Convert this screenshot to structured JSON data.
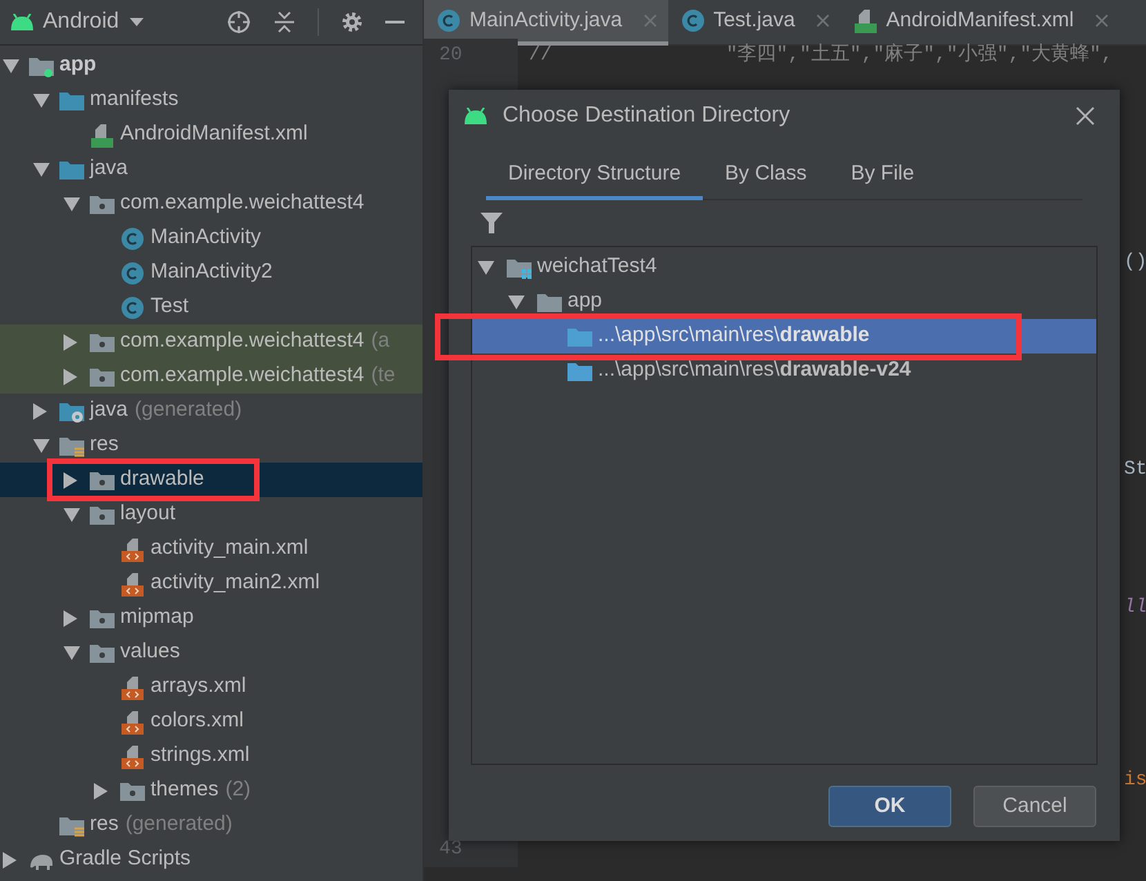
{
  "project_panel": {
    "view": "Android",
    "tree": [
      {
        "label": "app",
        "kind": "module",
        "bold": true,
        "expanded": true,
        "selected": false,
        "highlighted": false,
        "marked": false,
        "children": [
          {
            "label": "manifests",
            "kind": "folder",
            "expanded": true,
            "selected": false,
            "highlighted": false,
            "marked": false,
            "children": [
              {
                "label": "AndroidManifest.xml",
                "kind": "manifest",
                "selected": false,
                "highlighted": false,
                "marked": false
              }
            ]
          },
          {
            "label": "java",
            "kind": "folder",
            "expanded": true,
            "selected": false,
            "highlighted": false,
            "marked": false,
            "children": [
              {
                "label": "com.example.weichattest4",
                "kind": "package",
                "expanded": true,
                "selected": false,
                "highlighted": false,
                "marked": false,
                "children": [
                  {
                    "label": "MainActivity",
                    "kind": "class",
                    "selected": false,
                    "highlighted": false,
                    "marked": false
                  },
                  {
                    "label": "MainActivity2",
                    "kind": "class",
                    "selected": false,
                    "highlighted": false,
                    "marked": false
                  },
                  {
                    "label": "Test",
                    "kind": "class",
                    "selected": false,
                    "highlighted": false,
                    "marked": false
                  }
                ]
              },
              {
                "label": "com.example.weichattest4",
                "suffix": "(a",
                "kind": "package",
                "expanded": false,
                "selected": false,
                "highlighted": true,
                "marked": false
              },
              {
                "label": "com.example.weichattest4",
                "suffix": "(te",
                "kind": "package",
                "expanded": false,
                "selected": false,
                "highlighted": true,
                "marked": false
              }
            ]
          },
          {
            "label": "java",
            "suffix": "(generated)",
            "kind": "generated_folder",
            "expanded": false,
            "selected": false,
            "highlighted": false,
            "marked": false
          },
          {
            "label": "res",
            "kind": "res_folder",
            "expanded": true,
            "selected": false,
            "highlighted": false,
            "marked": false,
            "children": [
              {
                "label": "drawable",
                "kind": "package",
                "expanded": false,
                "selected": true,
                "highlighted": false,
                "marked": true
              },
              {
                "label": "layout",
                "kind": "package",
                "expanded": true,
                "selected": false,
                "highlighted": false,
                "marked": false,
                "children": [
                  {
                    "label": "activity_main.xml",
                    "kind": "xml",
                    "selected": false,
                    "highlighted": false,
                    "marked": false
                  },
                  {
                    "label": "activity_main2.xml",
                    "kind": "xml",
                    "selected": false,
                    "highlighted": false,
                    "marked": false
                  }
                ]
              },
              {
                "label": "mipmap",
                "kind": "package",
                "expanded": false,
                "selected": false,
                "highlighted": false,
                "marked": false
              },
              {
                "label": "values",
                "kind": "package",
                "expanded": true,
                "selected": false,
                "highlighted": false,
                "marked": false,
                "children": [
                  {
                    "label": "arrays.xml",
                    "kind": "xml",
                    "selected": false,
                    "highlighted": false,
                    "marked": false
                  },
                  {
                    "label": "colors.xml",
                    "kind": "xml",
                    "selected": false,
                    "highlighted": false,
                    "marked": false
                  },
                  {
                    "label": "strings.xml",
                    "kind": "xml",
                    "selected": false,
                    "highlighted": false,
                    "marked": false
                  },
                  {
                    "label": "themes",
                    "suffix": "(2)",
                    "kind": "package",
                    "expanded": false,
                    "selected": false,
                    "highlighted": false,
                    "marked": false
                  }
                ]
              }
            ]
          },
          {
            "label": "res",
            "suffix": "(generated)",
            "kind": "res_folder",
            "selected": false,
            "highlighted": false,
            "marked": false
          }
        ]
      },
      {
        "label": "Gradle Scripts",
        "kind": "gradle",
        "expanded": false,
        "selected": false,
        "highlighted": false,
        "marked": false
      }
    ]
  },
  "editor": {
    "tabs": [
      {
        "label": "MainActivity.java",
        "kind": "class",
        "selected": true
      },
      {
        "label": "Test.java",
        "kind": "class",
        "selected": false
      },
      {
        "label": "AndroidManifest.xml",
        "kind": "manifest",
        "selected": false
      }
    ],
    "rows": [
      {
        "number": "20",
        "code": "//               \"李四\",\"土五\",\"麻子\",\"小强\",\"大黄蜂\","
      },
      {},
      {},
      {},
      {},
      {},
      {
        "tail": "()",
        "kind": "plain"
      },
      {},
      {},
      {},
      {},
      {},
      {
        "tail": "St",
        "kind": "plain"
      },
      {},
      {},
      {},
      {
        "tail": "ll",
        "kind": "field"
      },
      {},
      {},
      {},
      {},
      {
        "tail": "is",
        "kind": "keyword"
      },
      {},
      {
        "number": "43"
      }
    ]
  },
  "dialog": {
    "title": "Choose Destination Directory",
    "tabs": [
      {
        "label": "Directory Structure",
        "selected": true
      },
      {
        "label": "By Class",
        "selected": false
      },
      {
        "label": "By File",
        "selected": false
      }
    ],
    "tree": [
      {
        "label": "weichatTest4",
        "kind": "project",
        "expanded": true,
        "selected": false,
        "marked": false,
        "children": [
          {
            "label": "app",
            "kind": "plain_folder",
            "expanded": true,
            "selected": false,
            "marked": false,
            "children": [
              {
                "label": "...\\app\\src\\main\\res\\**drawable**",
                "kind": "res_dir",
                "selected": true,
                "marked": true
              },
              {
                "label": "...\\app\\src\\main\\res\\**drawable-v24**",
                "kind": "res_dir",
                "selected": false,
                "marked": false
              }
            ]
          }
        ]
      }
    ],
    "buttons": [
      {
        "label": "OK",
        "default": true
      },
      {
        "label": "Cancel",
        "default": false
      }
    ]
  }
}
